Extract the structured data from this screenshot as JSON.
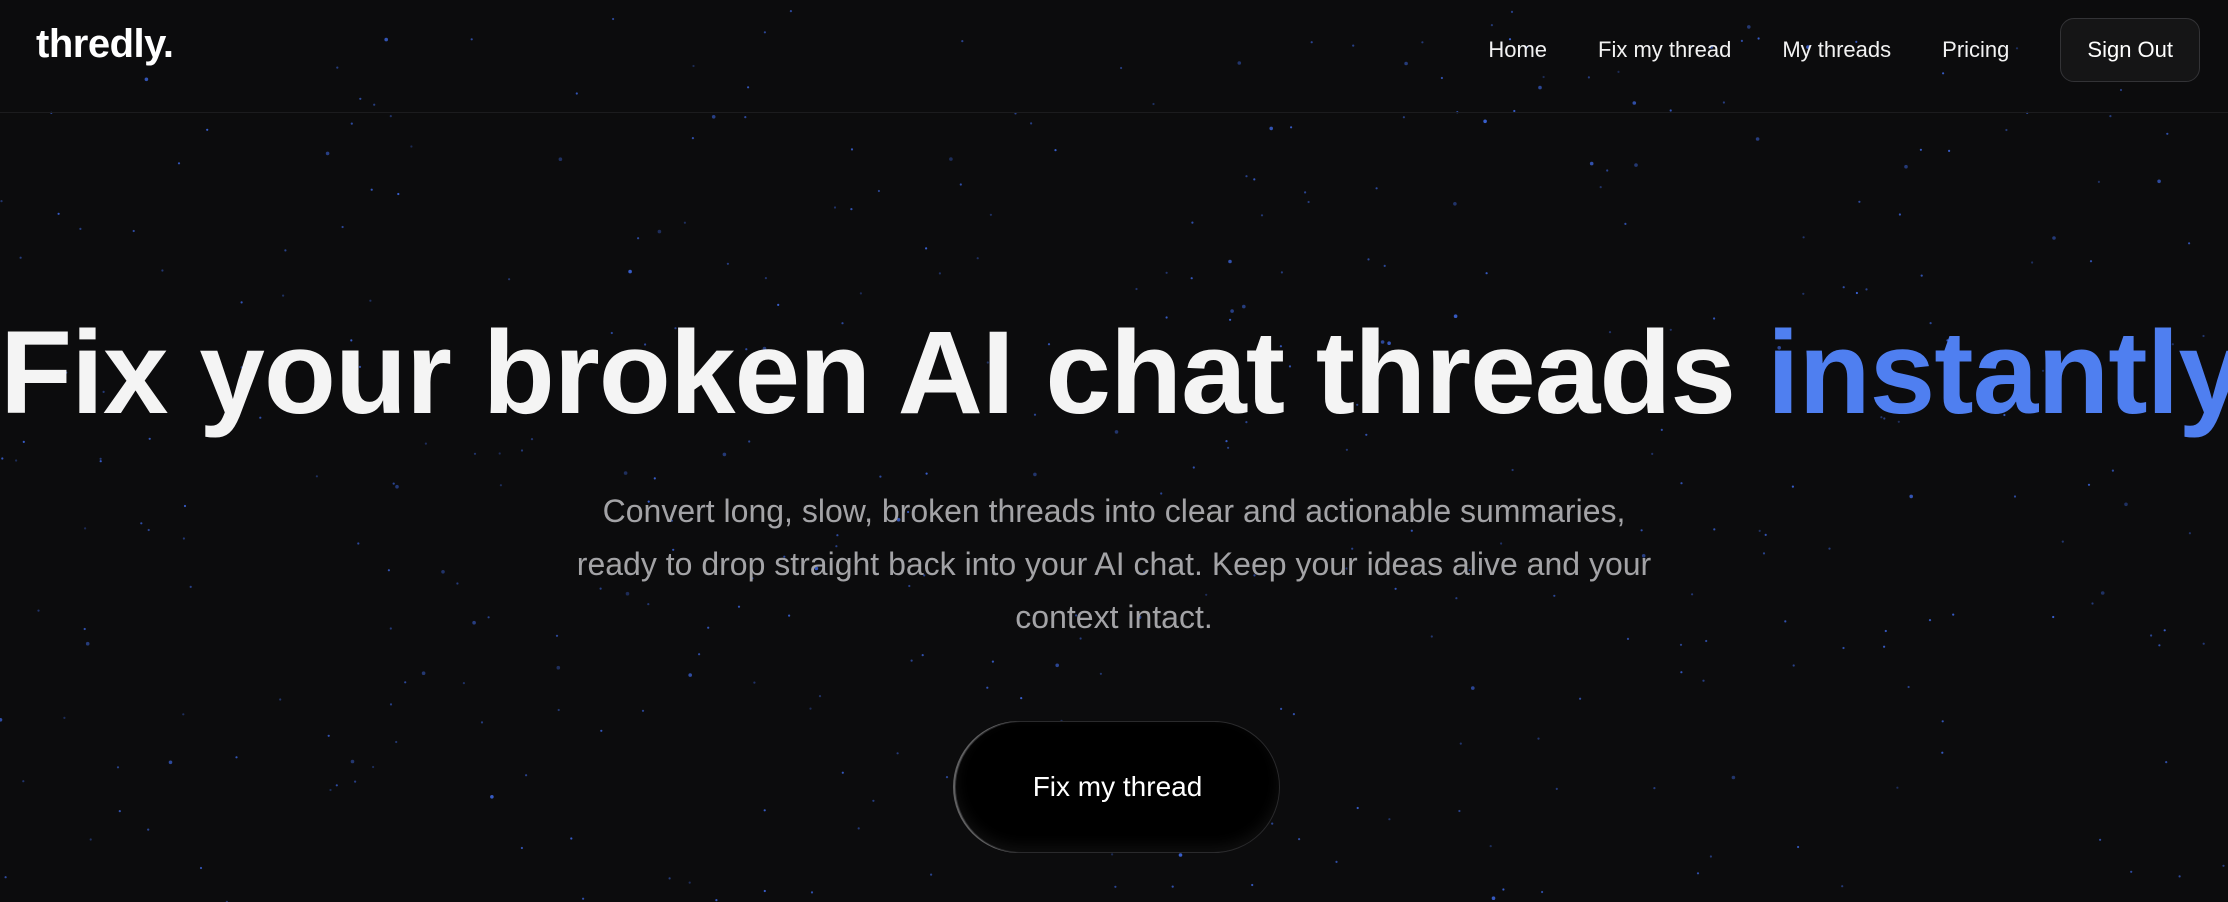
{
  "brand": {
    "logo": "thredly."
  },
  "nav": {
    "links": [
      {
        "label": "Home"
      },
      {
        "label": "Fix my thread"
      },
      {
        "label": "My threads"
      },
      {
        "label": "Pricing"
      }
    ],
    "sign_out_label": "Sign Out"
  },
  "hero": {
    "title_main": "Fix your broken AI chat threads ",
    "title_accent": "instantly",
    "subtitle": "Convert long, slow, broken threads into clear and actionable summaries, ready to drop straight back into your AI chat. Keep your ideas alive and your context intact.",
    "cta_label": "Fix my thread"
  },
  "colors": {
    "background": "#0c0c0d",
    "accent": "#4f7ff0",
    "star": "#3b63d6"
  }
}
